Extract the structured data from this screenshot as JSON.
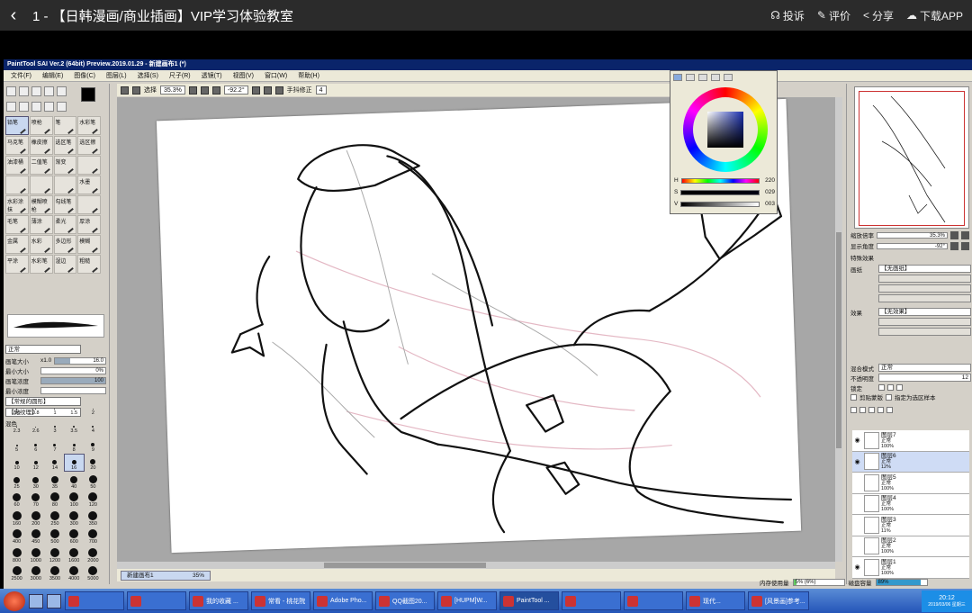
{
  "course": {
    "back_label": "‹",
    "title": "1 - 【日韩漫画/商业插画】VIP学习体验教室",
    "actions": [
      {
        "name": "report",
        "icon": "headset-icon",
        "glyph": "☊",
        "label": "投诉"
      },
      {
        "name": "review",
        "icon": "edit-icon",
        "glyph": "✎",
        "label": "评价"
      },
      {
        "name": "share",
        "icon": "share-icon",
        "glyph": "<",
        "label": "分享"
      },
      {
        "name": "download",
        "icon": "cloud-download-icon",
        "glyph": "☁",
        "label": "下载APP"
      }
    ]
  },
  "sai": {
    "window_title": "PaintTool SAI Ver.2 (64bit) Preview.2019.01.29 - 新建画布1 (*)",
    "menu": [
      "文件(F)",
      "编辑(E)",
      "图像(C)",
      "图层(L)",
      "选择(S)",
      "尺子(R)",
      "透镜(T)",
      "视图(V)",
      "窗口(W)",
      "帮助(H)"
    ],
    "options": {
      "select_label": "选择",
      "zoom": "35.3%",
      "angle": "-92.2°",
      "stabilizer_label": "手抖修正",
      "stabilizer_value": "4"
    },
    "brushes": [
      "铅笔",
      "喷枪",
      "笔",
      "水彩笔",
      "马克笔",
      "橡皮擦",
      "选区笔",
      "选区擦",
      "油漆桶",
      "二值笔",
      "渐变",
      "",
      "",
      "",
      "",
      "水墨",
      "水彩涂抹",
      "模糊喷枪",
      "勾线笔",
      "",
      "毛笔",
      "薄涂",
      "柔光",
      "厚涂",
      "金属",
      "水彩",
      "多边形",
      "模糊",
      "平涂",
      "水彩笔",
      "湿边",
      "粗糙"
    ],
    "brush_params": {
      "mode": "正常",
      "size_label": "画笔大小",
      "size_multiplier": "x1.0",
      "size_value": "16.0",
      "min_size_label": "最小大小",
      "min_size_value": "0%",
      "density_label": "画笔浓度",
      "density_value": "100",
      "min_density_label": "最小浓度",
      "shape_label": "【常规的圆形】",
      "texture_label": "【无纹理】",
      "blend_label": "混色"
    },
    "brush_sizes": [
      {
        "label": "0.6",
        "d": 1
      },
      {
        "label": "0.8",
        "d": 1
      },
      {
        "label": "1",
        "d": 1
      },
      {
        "label": "1.5",
        "d": 1
      },
      {
        "label": "2",
        "d": 1
      },
      {
        "label": "2.3",
        "d": 1
      },
      {
        "label": "2.6",
        "d": 1
      },
      {
        "label": "3",
        "d": 2
      },
      {
        "label": "3.5",
        "d": 2
      },
      {
        "label": "4",
        "d": 2
      },
      {
        "label": "5",
        "d": 2
      },
      {
        "label": "6",
        "d": 3
      },
      {
        "label": "7",
        "d": 3
      },
      {
        "label": "8",
        "d": 3
      },
      {
        "label": "9",
        "d": 4
      },
      {
        "label": "10",
        "d": 4
      },
      {
        "label": "12",
        "d": 4
      },
      {
        "label": "14",
        "d": 5
      },
      {
        "label": "16",
        "d": 5,
        "selected": true
      },
      {
        "label": "20",
        "d": 6
      },
      {
        "label": "25",
        "d": 7
      },
      {
        "label": "30",
        "d": 7
      },
      {
        "label": "35",
        "d": 8
      },
      {
        "label": "40",
        "d": 8
      },
      {
        "label": "50",
        "d": 9
      },
      {
        "label": "60",
        "d": 9
      },
      {
        "label": "70",
        "d": 9
      },
      {
        "label": "80",
        "d": 10
      },
      {
        "label": "100",
        "d": 10
      },
      {
        "label": "120",
        "d": 10
      },
      {
        "label": "160",
        "d": 10
      },
      {
        "label": "200",
        "d": 10
      },
      {
        "label": "250",
        "d": 10
      },
      {
        "label": "300",
        "d": 10
      },
      {
        "label": "350",
        "d": 10
      },
      {
        "label": "400",
        "d": 10
      },
      {
        "label": "450",
        "d": 10
      },
      {
        "label": "500",
        "d": 10
      },
      {
        "label": "600",
        "d": 10
      },
      {
        "label": "700",
        "d": 10
      },
      {
        "label": "800",
        "d": 10
      },
      {
        "label": "1000",
        "d": 10
      },
      {
        "label": "1200",
        "d": 10
      },
      {
        "label": "1600",
        "d": 10
      },
      {
        "label": "2000",
        "d": 10
      },
      {
        "label": "2500",
        "d": 10
      },
      {
        "label": "3000",
        "d": 10
      },
      {
        "label": "3500",
        "d": 10
      },
      {
        "label": "4000",
        "d": 10
      },
      {
        "label": "5000",
        "d": 10
      }
    ],
    "color": {
      "h_label": "H",
      "h_value": "220",
      "s_label": "S",
      "s_value": "029",
      "v_label": "V",
      "v_value": "003",
      "accent": "#1a2fb0"
    },
    "navigator": {
      "zoom_label": "缩放倍率",
      "zoom_value": "35.3%",
      "angle_label": "显示角度",
      "angle_value": "-92°"
    },
    "effects": {
      "header": "特殊效果",
      "paper_label": "画纸",
      "paper_value": "【无画纸】",
      "effect_label": "效果",
      "effect_value": "【无效果】"
    },
    "layer_props": {
      "blend_label": "混合模式",
      "blend_value": "正常",
      "opacity_label": "不透明度",
      "opacity_value": "12",
      "lock_label": "锁定",
      "clip_label": "剪贴蒙版",
      "ref_label": "指定为选区样本"
    },
    "layers": [
      {
        "name": "图层7",
        "mode": "正常",
        "opacity": "100%",
        "visible": true,
        "active": false
      },
      {
        "name": "图层6",
        "mode": "正常",
        "opacity": "12%",
        "visible": true,
        "active": true
      },
      {
        "name": "图层5",
        "mode": "正常",
        "opacity": "100%",
        "visible": false,
        "active": false
      },
      {
        "name": "图层4",
        "mode": "正常",
        "opacity": "100%",
        "visible": false,
        "active": false
      },
      {
        "name": "图层3",
        "mode": "正常",
        "opacity": "11%",
        "visible": false,
        "active": false
      },
      {
        "name": "图层2",
        "mode": "正常",
        "opacity": "100%",
        "visible": false,
        "active": false
      },
      {
        "name": "图层1",
        "mode": "正常",
        "opacity": "100%",
        "visible": true,
        "active": false
      }
    ],
    "canvas_tab": {
      "name": "新建画布1",
      "zoom": "35%"
    },
    "memory": {
      "mem_label": "内存使用量",
      "mem_value": "5% (6%)",
      "mem_fraction": 0.06,
      "disk_label": "磁盘容量",
      "disk_value": "89%",
      "disk_fraction": 0.89
    }
  },
  "taskbar": {
    "items": [
      "",
      "",
      "我的收藏 ...",
      "常看 - 桃花院",
      "Adobe Pho...",
      "QQ截图20...",
      "[HUPM]W...",
      "PaintTool ...",
      "",
      "",
      "现代...",
      "[风景画]参考..."
    ],
    "clock_time": "20:12",
    "clock_date": "2019/03/06 星期三"
  }
}
